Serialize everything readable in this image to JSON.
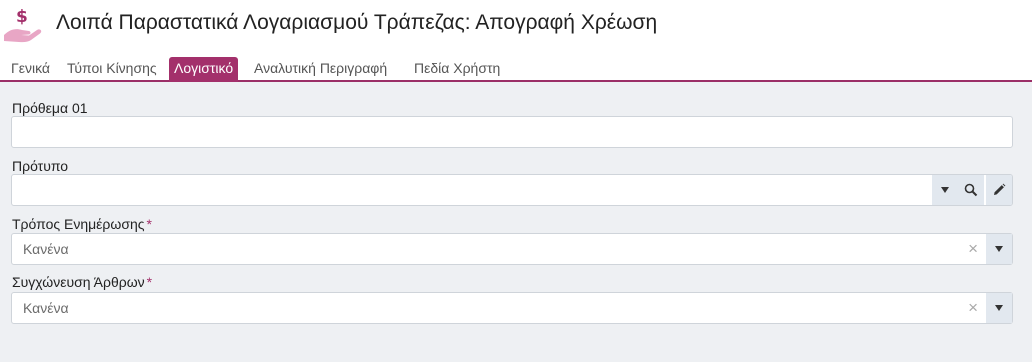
{
  "header": {
    "title": "Λοιπά Παραστατικά Λογαριασμού Τράπεζας: Απογραφή Χρέωση",
    "icon": "hand-dollar-icon",
    "accent": "#a3306b"
  },
  "tabs": [
    {
      "label": "Γενικά",
      "active": false
    },
    {
      "label": "Τύποι Κίνησης",
      "active": false
    },
    {
      "label": "Λογιστικό",
      "active": true
    },
    {
      "label": "Αναλυτική Περιγραφή",
      "active": false
    },
    {
      "label": "Πεδία Χρήστη",
      "active": false
    }
  ],
  "form": {
    "prothema": {
      "label": "Πρόθεμα 01",
      "value": ""
    },
    "protypo": {
      "label": "Πρότυπο",
      "value": ""
    },
    "tropos": {
      "label": "Τρόπος Ενημέρωσης",
      "required_mark": "*",
      "value": "Κανένα"
    },
    "sygxoneusi": {
      "label": "Συγχώνευση Άρθρων",
      "required_mark": "*",
      "value": "Κανένα"
    },
    "clear_glyph": "×"
  }
}
